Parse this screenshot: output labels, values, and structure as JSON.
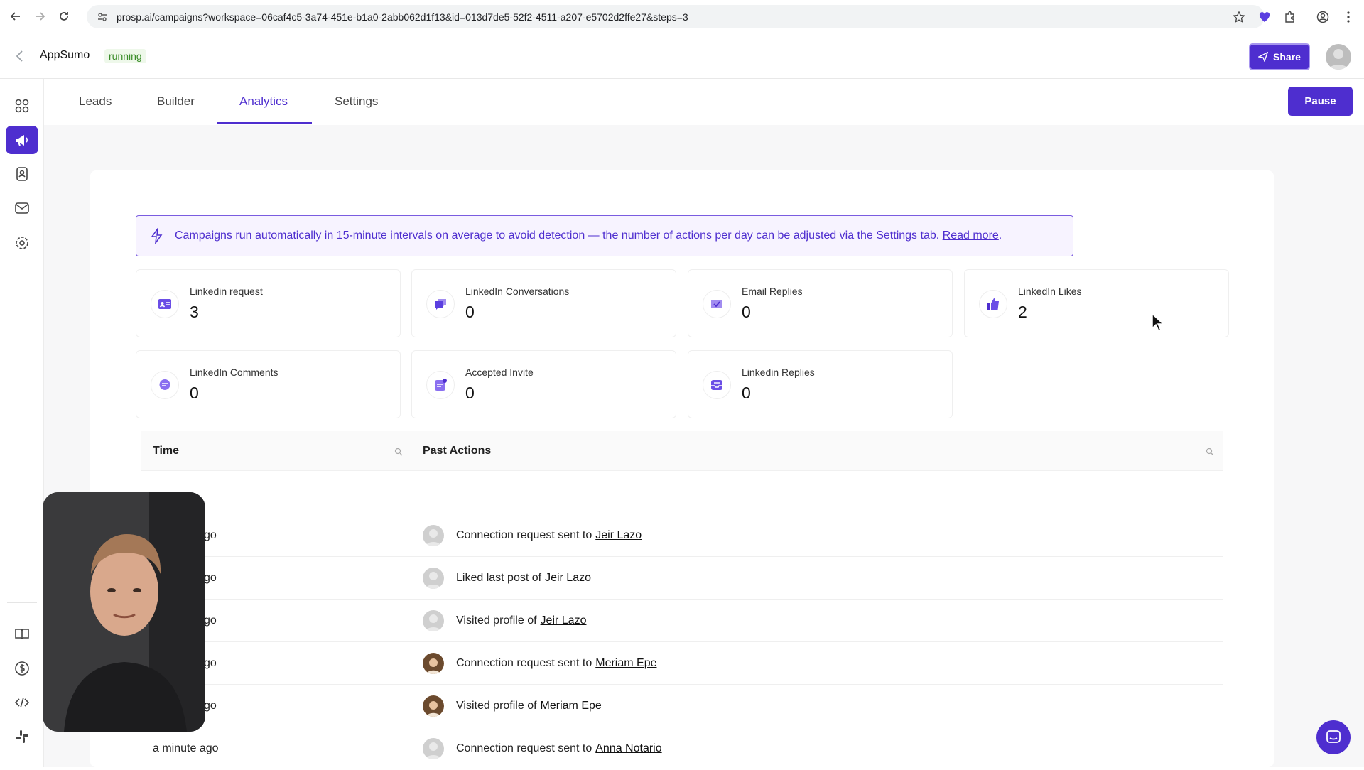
{
  "browser": {
    "url": "prosp.ai/campaigns?workspace=06caf4c5-3a74-451e-b1a0-2abb062d1f13&id=013d7de5-52f2-4511-a207-e5702d2ffe27&steps=3"
  },
  "header": {
    "campaign_name": "AppSumo",
    "status": "running",
    "share_label": "Share"
  },
  "tabs": [
    {
      "label": "Leads"
    },
    {
      "label": "Builder"
    },
    {
      "label": "Analytics"
    },
    {
      "label": "Settings"
    }
  ],
  "pause_label": "Pause",
  "banner": {
    "text": "Campaigns run automatically in 15-minute intervals on average to avoid detection — the number of actions per day can be adjusted via the Settings tab.",
    "link": "Read more",
    "suffix": "."
  },
  "stats": [
    {
      "label": "Linkedin request",
      "value": "3",
      "icon": "id-card-icon"
    },
    {
      "label": "LinkedIn Conversations",
      "value": "0",
      "icon": "chat-bubbles-icon"
    },
    {
      "label": "Email Replies",
      "value": "0",
      "icon": "mail-check-icon"
    },
    {
      "label": "LinkedIn Likes",
      "value": "2",
      "icon": "thumbs-up-icon"
    },
    {
      "label": "LinkedIn Comments",
      "value": "0",
      "icon": "comment-icon"
    },
    {
      "label": "Accepted Invite",
      "value": "0",
      "icon": "invite-icon"
    },
    {
      "label": "Linkedin Replies",
      "value": "0",
      "icon": "inbox-icon"
    }
  ],
  "table": {
    "col_time": "Time",
    "col_actions": "Past Actions",
    "rows": [
      {
        "time": "go",
        "action": "Connection request sent to",
        "lead": "Jeir Lazo"
      },
      {
        "time": "go",
        "action": "Liked last post of",
        "lead": "Jeir Lazo"
      },
      {
        "time": "go",
        "action": "Visited profile of",
        "lead": "Jeir Lazo"
      },
      {
        "time": "go",
        "action": "Connection request sent to",
        "lead": "Meriam Epe"
      },
      {
        "time": "go",
        "action": "Visited profile of",
        "lead": "Meriam Epe"
      },
      {
        "time": "a minute ago",
        "action": "Connection request sent to",
        "lead": "Anna Notario"
      }
    ]
  },
  "colors": {
    "accent": "#4e2ecf",
    "status_green": "#3b8d2a"
  }
}
